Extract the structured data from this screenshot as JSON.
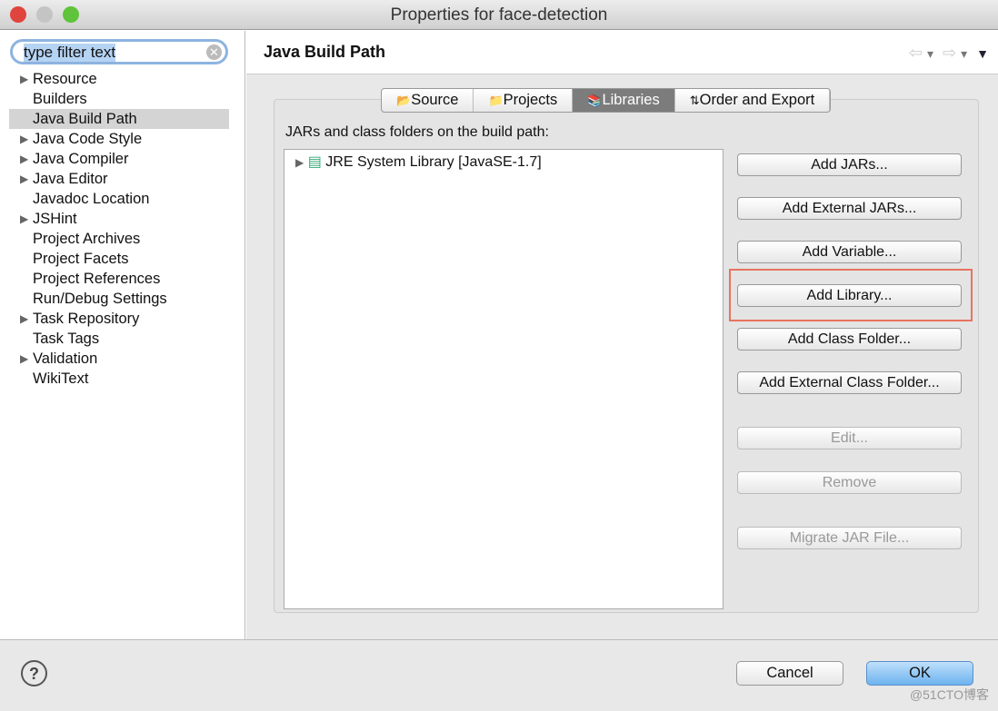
{
  "window": {
    "title": "Properties for face-detection"
  },
  "sidebar": {
    "filter_value": "type filter text",
    "items": [
      {
        "label": "Resource",
        "expandable": true
      },
      {
        "label": "Builders",
        "expandable": false
      },
      {
        "label": "Java Build Path",
        "expandable": false,
        "selected": true
      },
      {
        "label": "Java Code Style",
        "expandable": true
      },
      {
        "label": "Java Compiler",
        "expandable": true
      },
      {
        "label": "Java Editor",
        "expandable": true
      },
      {
        "label": "Javadoc Location",
        "expandable": false
      },
      {
        "label": "JSHint",
        "expandable": true
      },
      {
        "label": "Project Archives",
        "expandable": false
      },
      {
        "label": "Project Facets",
        "expandable": false
      },
      {
        "label": "Project References",
        "expandable": false
      },
      {
        "label": "Run/Debug Settings",
        "expandable": false
      },
      {
        "label": "Task Repository",
        "expandable": true
      },
      {
        "label": "Task Tags",
        "expandable": false
      },
      {
        "label": "Validation",
        "expandable": true
      },
      {
        "label": "WikiText",
        "expandable": false
      }
    ]
  },
  "main": {
    "title": "Java Build Path",
    "tabs": [
      {
        "label": "Source",
        "icon": "source-folder-icon"
      },
      {
        "label": "Projects",
        "icon": "folder-icon"
      },
      {
        "label": "Libraries",
        "icon": "library-icon",
        "active": true
      },
      {
        "label": "Order and Export",
        "icon": "order-icon"
      }
    ],
    "list_label": "JARs and class folders on the build path:",
    "entries": [
      {
        "label": "JRE System Library [JavaSE-1.7]"
      }
    ],
    "buttons": [
      {
        "label": "Add JARs...",
        "enabled": true
      },
      {
        "label": "Add External JARs...",
        "enabled": true
      },
      {
        "label": "Add Variable...",
        "enabled": true
      },
      {
        "label": "Add Library...",
        "enabled": true,
        "highlighted": true
      },
      {
        "label": "Add Class Folder...",
        "enabled": true
      },
      {
        "label": "Add External Class Folder...",
        "enabled": true
      },
      {
        "label": "Edit...",
        "enabled": false
      },
      {
        "label": "Remove",
        "enabled": false
      },
      {
        "label": "Migrate JAR File...",
        "enabled": false
      }
    ]
  },
  "footer": {
    "help": "?",
    "cancel": "Cancel",
    "ok": "OK"
  },
  "watermark": "@51CTO博客",
  "colors": {
    "highlight_box": "#e8735f",
    "selected_item": "#d4d4d4",
    "ok_button": "#6db3ef"
  }
}
